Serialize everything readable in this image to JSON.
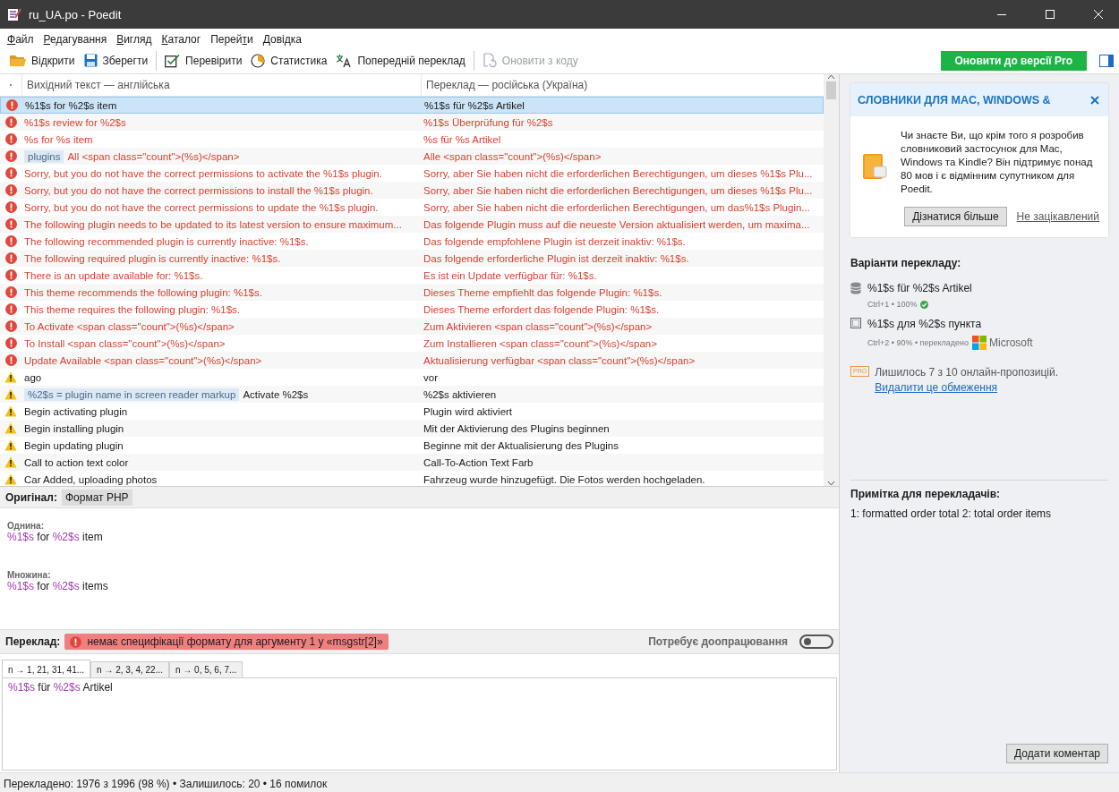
{
  "window": {
    "title": "ru_UA.po - Poedit"
  },
  "menu": [
    {
      "key": "Ф",
      "after": "айл"
    },
    {
      "key": "Р",
      "after": "едагування"
    },
    {
      "key": "В",
      "after": "игляд"
    },
    {
      "key": "К",
      "after": "аталог"
    },
    {
      "before": "Перей",
      "key": "т",
      "after": "и"
    },
    {
      "key": "Д",
      "after": "овідка"
    }
  ],
  "toolbar": {
    "groups": [
      [
        {
          "kind": "open",
          "label": "Відкрити",
          "disabled": false
        },
        {
          "kind": "save",
          "label": "Зберегти",
          "disabled": false
        }
      ],
      [
        {
          "kind": "validate",
          "label": "Перевірити",
          "disabled": false
        },
        {
          "kind": "stats",
          "label": "Статистика",
          "disabled": false
        },
        {
          "kind": "translate",
          "label": "Попередній переклад",
          "disabled": false
        }
      ],
      [
        {
          "kind": "update",
          "label": "Оновити з коду",
          "disabled": true
        }
      ]
    ],
    "upgrade_button": "Оновити до версії Pro"
  },
  "list": {
    "columns": [
      "Вихідний текст — англійська",
      "Переклад — російська (Україна)"
    ],
    "rows": [
      {
        "kind": "error",
        "selected": true,
        "source": "%1$s for %2$s item",
        "translation": "%1$s für %2$s Artikel"
      },
      {
        "kind": "error",
        "selected": false,
        "source": "%1$s review for %2$s",
        "translation": "%1$s Überprüfung für %2$s"
      },
      {
        "kind": "error",
        "selected": false,
        "source": "%s for %s item",
        "translation": "%s für %s Artikel"
      },
      {
        "kind": "error",
        "selected": false,
        "context": "plugins",
        "source": "All <span class=\"count\">(%s)</span>",
        "translation": "Alle <span class=\"count\">(%s)</span>"
      },
      {
        "kind": "error",
        "selected": false,
        "source": "Sorry, but you do not have the correct permissions to activate the %1$s plugin.",
        "translation": "Sorry, aber Sie haben nicht die erforderlichen Berechtigungen, um dieses %1$s Plu..."
      },
      {
        "kind": "error",
        "selected": false,
        "source": "Sorry, but you do not have the correct permissions to install the %1$s plugin.",
        "translation": "Sorry, aber Sie haben nicht die erforderlichen Berechtigungen, um dieses %1$s Plu..."
      },
      {
        "kind": "error",
        "selected": false,
        "source": "Sorry, but you do not have the correct permissions to update the %1$s plugin.",
        "translation": "Sorry, aber Sie haben nicht die erforderlichen Berechtigungen, um das%1$s Plugin..."
      },
      {
        "kind": "error",
        "selected": false,
        "source": "The following plugin needs to be updated to its latest version to ensure maximum...",
        "translation": "Das folgende Plugin muss auf die neueste Version aktualisiert werden, um maxima..."
      },
      {
        "kind": "error",
        "selected": false,
        "source": "The following recommended plugin is currently inactive: %1$s.",
        "translation": "Das folgende empfohlene Plugin ist derzeit inaktiv: %1$s."
      },
      {
        "kind": "error",
        "selected": false,
        "source": "The following required plugin is currently inactive: %1$s.",
        "translation": "Das folgende erforderliche Plugin ist derzeit inaktiv: %1$s."
      },
      {
        "kind": "error",
        "selected": false,
        "source": "There is an update available for: %1$s.",
        "translation": "Es ist ein Update verfügbar für: %1$s."
      },
      {
        "kind": "error",
        "selected": false,
        "source": "This theme recommends the following plugin: %1$s.",
        "translation": "Dieses Theme empfiehlt das folgende Plugin: %1$s."
      },
      {
        "kind": "error",
        "selected": false,
        "source": "This theme requires the following plugin: %1$s.",
        "translation": "Dieses Theme erfordert das folgende Plugin: %1$s."
      },
      {
        "kind": "error",
        "selected": false,
        "source": "To Activate <span class=\"count\">(%s)</span>",
        "translation": "Zum Aktivieren <span class=\"count\">(%s)</span>"
      },
      {
        "kind": "error",
        "selected": false,
        "source": "To Install <span class=\"count\">(%s)</span>",
        "translation": "Zum Installieren <span class=\"count\">(%s)</span>"
      },
      {
        "kind": "error",
        "selected": false,
        "source": "Update Available <span class=\"count\">(%s)</span>",
        "translation": "Aktualisierung verfügbar <span class=\"count\">(%s)</span>"
      },
      {
        "kind": "warning",
        "selected": false,
        "source": "ago",
        "translation": "vor"
      },
      {
        "kind": "warning",
        "selected": false,
        "context": "%2$s = plugin name in screen reader markup",
        "source": "Activate %2$s",
        "translation": "%2$s aktivieren"
      },
      {
        "kind": "warning",
        "selected": false,
        "source": "Begin activating plugin",
        "translation": "Plugin wird aktiviert"
      },
      {
        "kind": "warning",
        "selected": false,
        "source": "Begin installing plugin",
        "translation": "Mit der Aktivierung des Plugins beginnen"
      },
      {
        "kind": "warning",
        "selected": false,
        "source": "Begin updating plugin",
        "translation": "Beginne mit der Aktualisierung des Plugins"
      },
      {
        "kind": "warning",
        "selected": false,
        "source": "Call to action text color",
        "translation": "Call-To-Action Text Farb"
      },
      {
        "kind": "warning",
        "selected": false,
        "source": "Car Added, uploading photos",
        "translation": "Fahrzeug wurde hinzugefügt. Die Fotos werden hochgeladen."
      }
    ]
  },
  "original": {
    "label": "Оригінал:",
    "format_tag": "Формат PHP",
    "forms": [
      {
        "label": "Однина:",
        "segments": [
          {
            "kind": "placeholder",
            "text": "%1$s"
          },
          {
            "kind": "plain",
            "text": " for "
          },
          {
            "kind": "placeholder",
            "text": "%2$s"
          },
          {
            "kind": "plain",
            "text": " item"
          }
        ]
      },
      {
        "label": "Множина:",
        "segments": [
          {
            "kind": "placeholder",
            "text": "%1$s"
          },
          {
            "kind": "plain",
            "text": " for "
          },
          {
            "kind": "placeholder",
            "text": "%2$s"
          },
          {
            "kind": "plain",
            "text": " items"
          }
        ]
      }
    ]
  },
  "translation": {
    "label": "Переклад:",
    "error": "немає специфікації формату для аргументу 1 у «msgstr[2]»",
    "needs_work": {
      "label": "Потребує доопрацювання",
      "on": false
    },
    "tabs": [
      {
        "label": "n → 1, 21, 31, 41...",
        "selected": true
      },
      {
        "label": "n → 2, 3, 4, 22...",
        "selected": false
      },
      {
        "label": "n → 0, 5, 6, 7...",
        "selected": false
      }
    ],
    "segments": [
      {
        "kind": "placeholder",
        "text": "%1$s"
      },
      {
        "kind": "plain",
        "text": " für "
      },
      {
        "kind": "placeholder",
        "text": "%2$s"
      },
      {
        "kind": "plain",
        "text": " Artikel"
      }
    ]
  },
  "sidebar": {
    "promo": {
      "title": "СЛОВНИКИ ДЛЯ MAC, WINDOWS &",
      "body": "Чи знаєте Ви, що крім того я розробив словниковий застосунок для Mac, Windows та Kindle? Він підтримує понад 80 мов і є відмінним супутником для Poedit.",
      "button": "Дізнатися більше",
      "link": "Не зацікавлений"
    },
    "suggestions_title": "Варіанти перекладу:",
    "suggestions": [
      {
        "kind": "memory",
        "text": "%1$s für %2$s Artikel",
        "meta": "Ctrl+1 • 100%",
        "verified": true
      },
      {
        "kind": "machine",
        "text": "%1$s для %2$s пункта",
        "meta": "Ctrl+2 • 90% • перекладено",
        "verified": false,
        "provider": "Microsoft"
      }
    ],
    "pro": {
      "badge": "PRO",
      "text": "Лишилось 7 з 10 онлайн-пропозицій.",
      "link": "Видалити це обмеження"
    },
    "notes_title": "Примітка для перекладачів:",
    "notes": "1: formatted order total 2: total order items",
    "comment_button": "Додати коментар"
  },
  "status_bar": "Перекладено: 1976 з 1996 (98 %)  •  Залишилось: 20  •  16 помилок"
}
